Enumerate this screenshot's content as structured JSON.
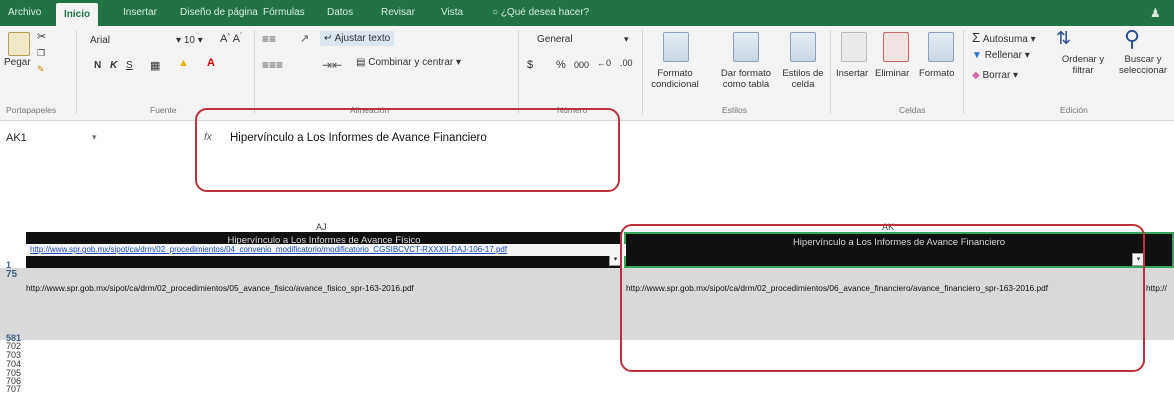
{
  "tabs": [
    {
      "label": "Archivo"
    },
    {
      "label": "Inicio"
    },
    {
      "label": "Insertar"
    },
    {
      "label": "Diseño de página"
    },
    {
      "label": "Fórmulas"
    },
    {
      "label": "Datos"
    },
    {
      "label": "Revisar"
    },
    {
      "label": "Vista"
    }
  ],
  "tell_me": "¿Qué desea hacer?",
  "clipboard": {
    "paste": "Pegar",
    "group": "Portapapeles"
  },
  "font": {
    "name": "Arial",
    "size": "10",
    "group": "Fuente",
    "bold": "N",
    "italic": "K",
    "underline": "S"
  },
  "alignment": {
    "wrap": "Ajustar texto",
    "merge": "Combinar y centrar",
    "group": "Alineación"
  },
  "number": {
    "format": "General",
    "currency": "$",
    "percent": "%",
    "thousands": "000",
    "group": "Número"
  },
  "styles": {
    "conditional": "Formato condicional",
    "as_table": "Dar formato como tabla",
    "cell_styles": "Estilos de celda",
    "group": "Estilos"
  },
  "cells": {
    "insert": "Insertar",
    "delete": "Eliminar",
    "format": "Formato",
    "group": "Celdas"
  },
  "editing": {
    "autosum": "Autosuma",
    "fill": "Rellenar",
    "clear": "Borrar",
    "sort": "Ordenar y filtrar",
    "find": "Buscar y seleccionar",
    "group": "Edición"
  },
  "formula_bar": {
    "name_box": "AK1",
    "fx": "fx",
    "content": "Hipervínculo a Los Informes de Avance Financiero"
  },
  "columns": {
    "aj": "AJ",
    "ak": "AK"
  },
  "headers": {
    "aj": "Hipervínculo a Los Informes de Avance Físico",
    "ak": "Hipervínculo a Los Informes de Avance Financiero"
  },
  "rows": {
    "r1": "1",
    "r75": "75",
    "r581": "581",
    "r702": "702",
    "r703": "703",
    "r704": "704",
    "r705": "705",
    "r706": "706",
    "r707": "707"
  },
  "cells_data": {
    "link_row": "http://www.spr.gob.mx/sipot/ca/drm/02_procedimientos/04_convenio_modificatorio/modificatorio_CGSIBCVCT-RXXXII-DAJ-106-17.pdf",
    "aj75": "http://www.spr.gob.mx/sipot/ca/drm/02_procedimientos/05_avance_fisico/avance_fisico_spr-163-2016.pdf",
    "ak75": "http://www.spr.gob.mx/sipot/ca/drm/02_procedimientos/06_avance_financiero/avance_financiero_spr-163-2016.pdf",
    "al75": "http://"
  },
  "accent": "#217346",
  "highlight": "#c0303b"
}
